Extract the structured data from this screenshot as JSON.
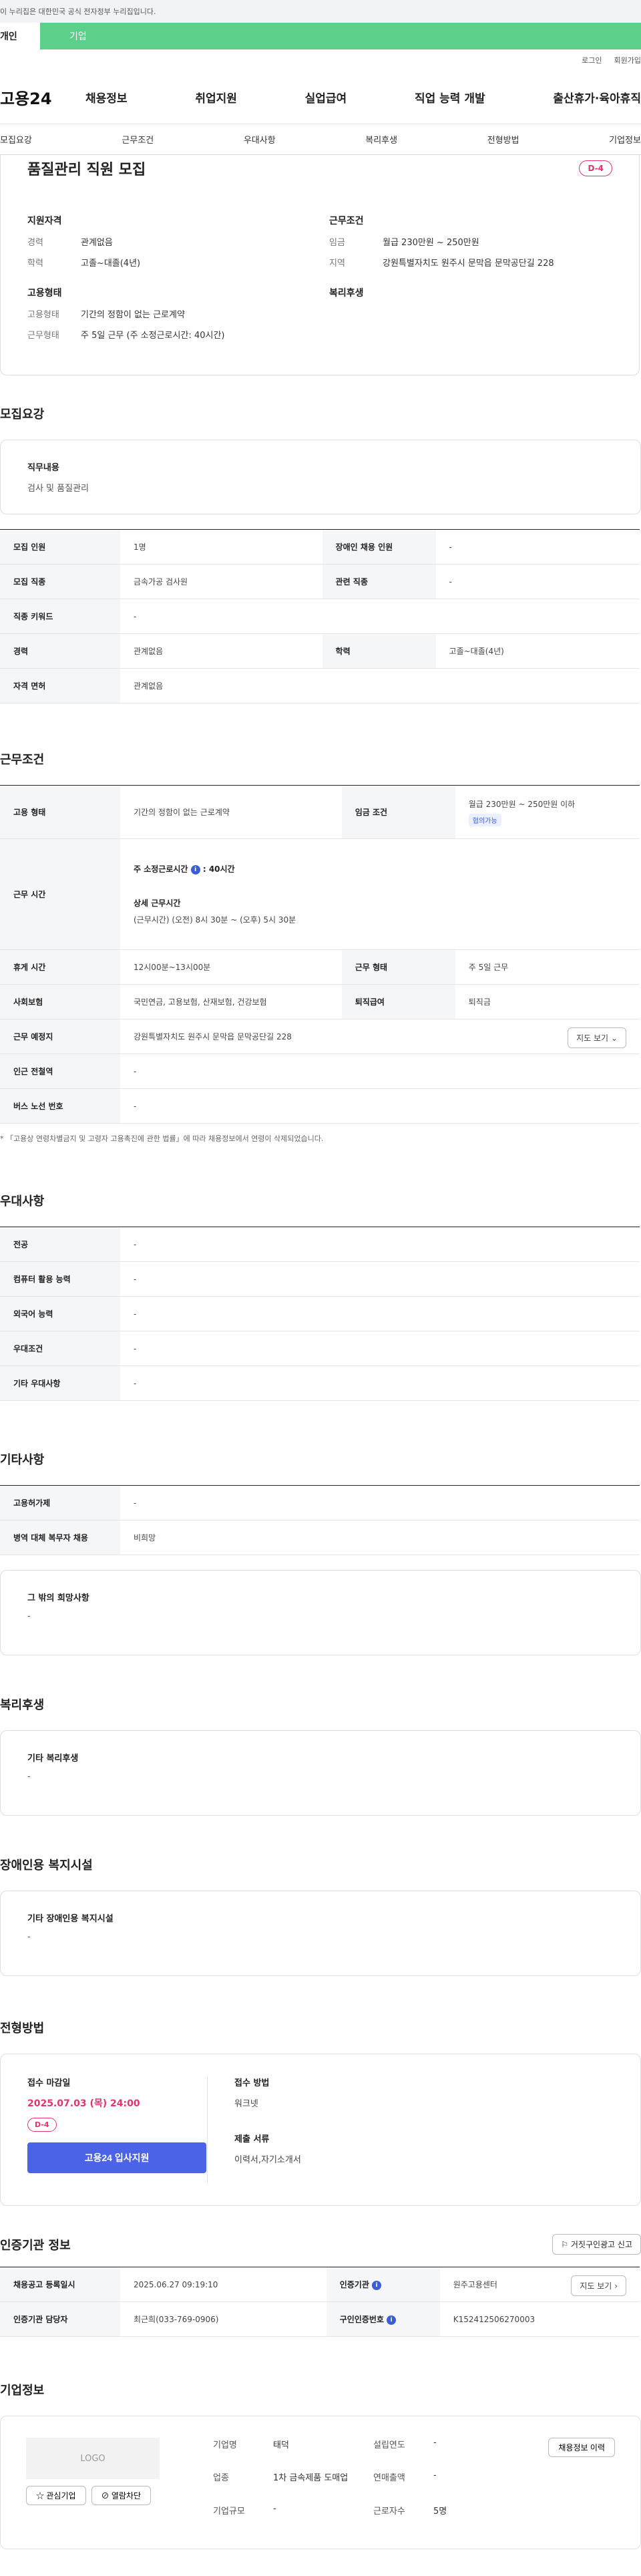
{
  "gov_banner": "이 누리집은 대한민국 공식 전자정부 누리집입니다.",
  "user_tabs": {
    "personal": "개인",
    "company": "기업"
  },
  "util": {
    "login": "로그인",
    "join": "회원가입"
  },
  "logo": "고용24",
  "gnb": [
    "채용정보",
    "취업지원",
    "실업급여",
    "직업 능력 개발",
    "출산휴가·육아휴직"
  ],
  "anchors": [
    "모집요강",
    "근무조건",
    "우대사항",
    "복리후생",
    "전형방법",
    "기업정보"
  ],
  "summary": {
    "title": "품질관리 직원 모집",
    "dday": "D-4",
    "qualification_h": "지원자격",
    "career_k": "경력",
    "career_v": "관계없음",
    "edu_k": "학력",
    "edu_v": "고졸~대졸(4년)",
    "employ_h": "고용형태",
    "employ_k": "고용형태",
    "employ_v": "기간의 정함이 없는 근로계약",
    "worktype_k": "근무형태",
    "worktype_v": "주 5일 근무 (주 소정근로시간: 40시간)",
    "cond_h": "근무조건",
    "wage_k": "임금",
    "wage_v": "월급 230만원 ~ 250만원",
    "area_k": "지역",
    "area_v": "강원특별자치도 원주시 문막읍 문막공단길 228",
    "welfare_h": "복리후생"
  },
  "recruit": {
    "title": "모집요강",
    "duty_h": "직무내용",
    "duty_v": "검사 및 품질관리",
    "rows": {
      "headcount_k": "모집 인원",
      "headcount_v": "1명",
      "disabled_k": "장애인 채용 인원",
      "disabled_v": "-",
      "job_k": "모집 직종",
      "job_v": "금속가공 검사원",
      "related_k": "관련 직종",
      "related_v": "-",
      "keyword_k": "직종 키워드",
      "keyword_v": "-",
      "career_k": "경력",
      "career_v": "관계없음",
      "edu_k": "학력",
      "edu_v": "고졸~대졸(4년)",
      "license_k": "자격 면허",
      "license_v": "관계없음"
    }
  },
  "work": {
    "title": "근무조건",
    "employ_k": "고용 형태",
    "employ_v": "기간의 정함이 없는 근로계약",
    "wage_k": "임금 조건",
    "wage_v": "월급 230만원 ~ 250만원 이하",
    "wage_tag": "협의가능",
    "time_k": "근무 시간",
    "time_std": "주 소정근로시간",
    "time_std_v": ": 40시간",
    "time_detail_h": "상세 근무시간",
    "time_detail_v": "(근무시간) (오전) 8시 30분 ~ (오후) 5시 30분",
    "rest_k": "휴게 시간",
    "rest_v": "12시00분~13시00분",
    "worktype_k": "근무 형태",
    "worktype_v": "주 5일 근무",
    "insurance_k": "사회보험",
    "insurance_v": "국민연금, 고용보험, 산재보험, 건강보험",
    "severance_k": "퇴직급여",
    "severance_v": "퇴직금",
    "place_k": "근무 예정지",
    "place_v": "강원특별자치도 원주시 문막읍 문막공단길 228",
    "map_btn": "지도 보기",
    "subway_k": "인근 전철역",
    "subway_v": "-",
    "bus_k": "버스 노선 번호",
    "bus_v": "-",
    "note": "「고용상 연령차별금지 및 고령자 고용촉진에 관한 법률」에 따라 채용정보에서 연령이 삭제되었습니다."
  },
  "pref": {
    "title": "우대사항",
    "major_k": "전공",
    "major_v": "-",
    "computer_k": "컴퓨터 활용 능력",
    "computer_v": "-",
    "lang_k": "외국어 능력",
    "lang_v": "-",
    "cond_k": "우대조건",
    "cond_v": "-",
    "etc_k": "기타 우대사항",
    "etc_v": "-"
  },
  "other": {
    "title": "기타사항",
    "permit_k": "고용허가제",
    "permit_v": "-",
    "military_k": "병역 대체 복무자 채용",
    "military_v": "비희망",
    "wish_h": "그 밖의 희망사항",
    "wish_v": "-"
  },
  "welfare": {
    "title": "복리후생",
    "h": "기타 복리후생",
    "v": "-"
  },
  "disabled_fac": {
    "title": "장애인용 복지시설",
    "h": "기타 장애인용 복지시설",
    "v": "-"
  },
  "process": {
    "title": "전형방법",
    "deadline_h": "접수 마감일",
    "deadline_v": "2025.07.03 (목) 24:00",
    "dday": "D-4",
    "apply_btn": "고용24 입사지원",
    "method_h": "접수 방법",
    "method_v": "워크넷",
    "docs_h": "제출 서류",
    "docs_v": "이력서,자기소개서"
  },
  "auth": {
    "title": "인증기관 정보",
    "report_btn": "거짓구인광고 신고",
    "reg_k": "채용공고 등록일시",
    "reg_v": "2025.06.27 09:19:10",
    "org_k": "인증기관",
    "org_v": "원주고용센터",
    "map_btn": "지도 보기",
    "manager_k": "인증기관 담당자",
    "manager_v": "최근희(033-769-0906)",
    "cert_k": "구인인증번호",
    "cert_v": "K152412506270003"
  },
  "company": {
    "title": "기업정보",
    "logo": "LOGO",
    "interest_btn": "관심기업",
    "block_btn": "열람차단",
    "name_k": "기업명",
    "name_v": "태덕",
    "industry_k": "업종",
    "industry_v": "1차 금속제품 도매업",
    "size_k": "기업규모",
    "size_v": "-",
    "founded_k": "설립연도",
    "founded_v": "-",
    "sales_k": "연매출액",
    "sales_v": "-",
    "staff_k": "근로자수",
    "staff_v": "5명",
    "history_btn": "채용정보 이력"
  }
}
